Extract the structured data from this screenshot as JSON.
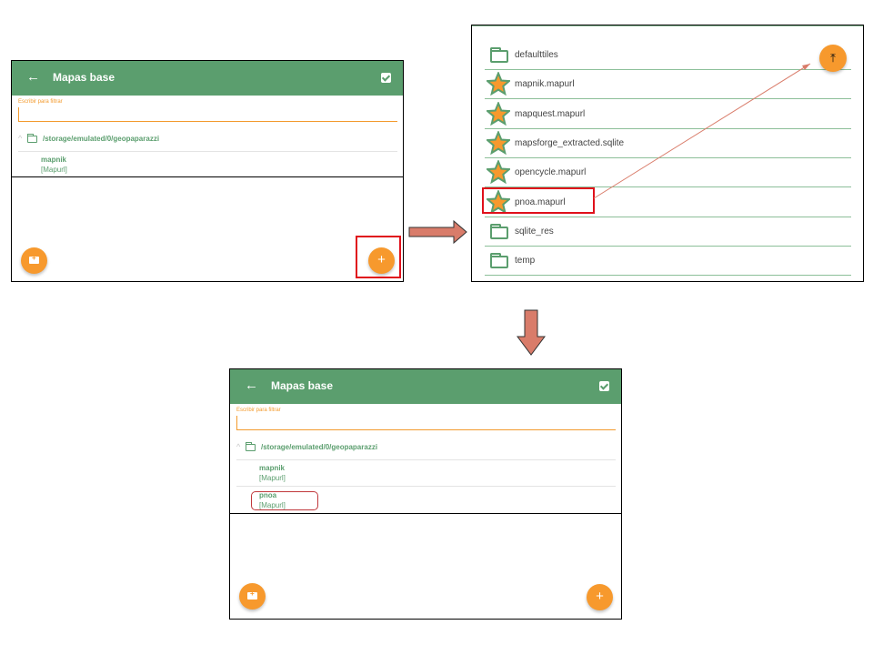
{
  "mapas_before": {
    "title": "Mapas base",
    "back_icon": "arrow-left-icon",
    "select_icon": "checkbox-checked-icon",
    "filter_placeholder": "Escribir para filtrar",
    "path": "/storage/emulated/0/geopaparazzi",
    "entries": [
      {
        "name": "mapnik",
        "type": "[Mapurl]"
      }
    ],
    "fab_add_folder_icon": "add-folder-icon",
    "fab_add_icon": "plus-icon",
    "fab_add_label": "+"
  },
  "file_chooser": {
    "top_fab_icon": "go-to-top-icon",
    "top_fab_glyph": "⤒",
    "items": [
      {
        "name": "defaulttiles",
        "icon": "folder-icon"
      },
      {
        "name": "mapnik.mapurl",
        "icon": "star-icon"
      },
      {
        "name": "mapquest.mapurl",
        "icon": "star-icon"
      },
      {
        "name": "mapsforge_extracted.sqlite",
        "icon": "star-icon"
      },
      {
        "name": "opencycle.mapurl",
        "icon": "star-icon"
      },
      {
        "name": "pnoa.mapurl",
        "icon": "star-icon"
      },
      {
        "name": "sqlite_res",
        "icon": "folder-icon"
      },
      {
        "name": "temp",
        "icon": "folder-icon"
      }
    ]
  },
  "mapas_after": {
    "title": "Mapas base",
    "back_icon": "arrow-left-icon",
    "select_icon": "checkbox-checked-icon",
    "filter_placeholder": "Escribir para filtrar",
    "path": "/storage/emulated/0/geopaparazzi",
    "entries": [
      {
        "name": "mapnik",
        "type": "[Mapurl]"
      },
      {
        "name": "pnoa",
        "type": "[Mapurl]"
      }
    ],
    "fab_add_folder_icon": "add-folder-icon",
    "fab_add_icon": "plus-icon",
    "fab_add_label": "+"
  },
  "colors": {
    "appbar_green": "#5b9e6e",
    "accent_orange": "#f7992d",
    "highlight_red": "#e0111b",
    "flow_arrow": "#d97c6a",
    "star_fill": "#f7992d",
    "star_outline": "#5b9e6e"
  }
}
